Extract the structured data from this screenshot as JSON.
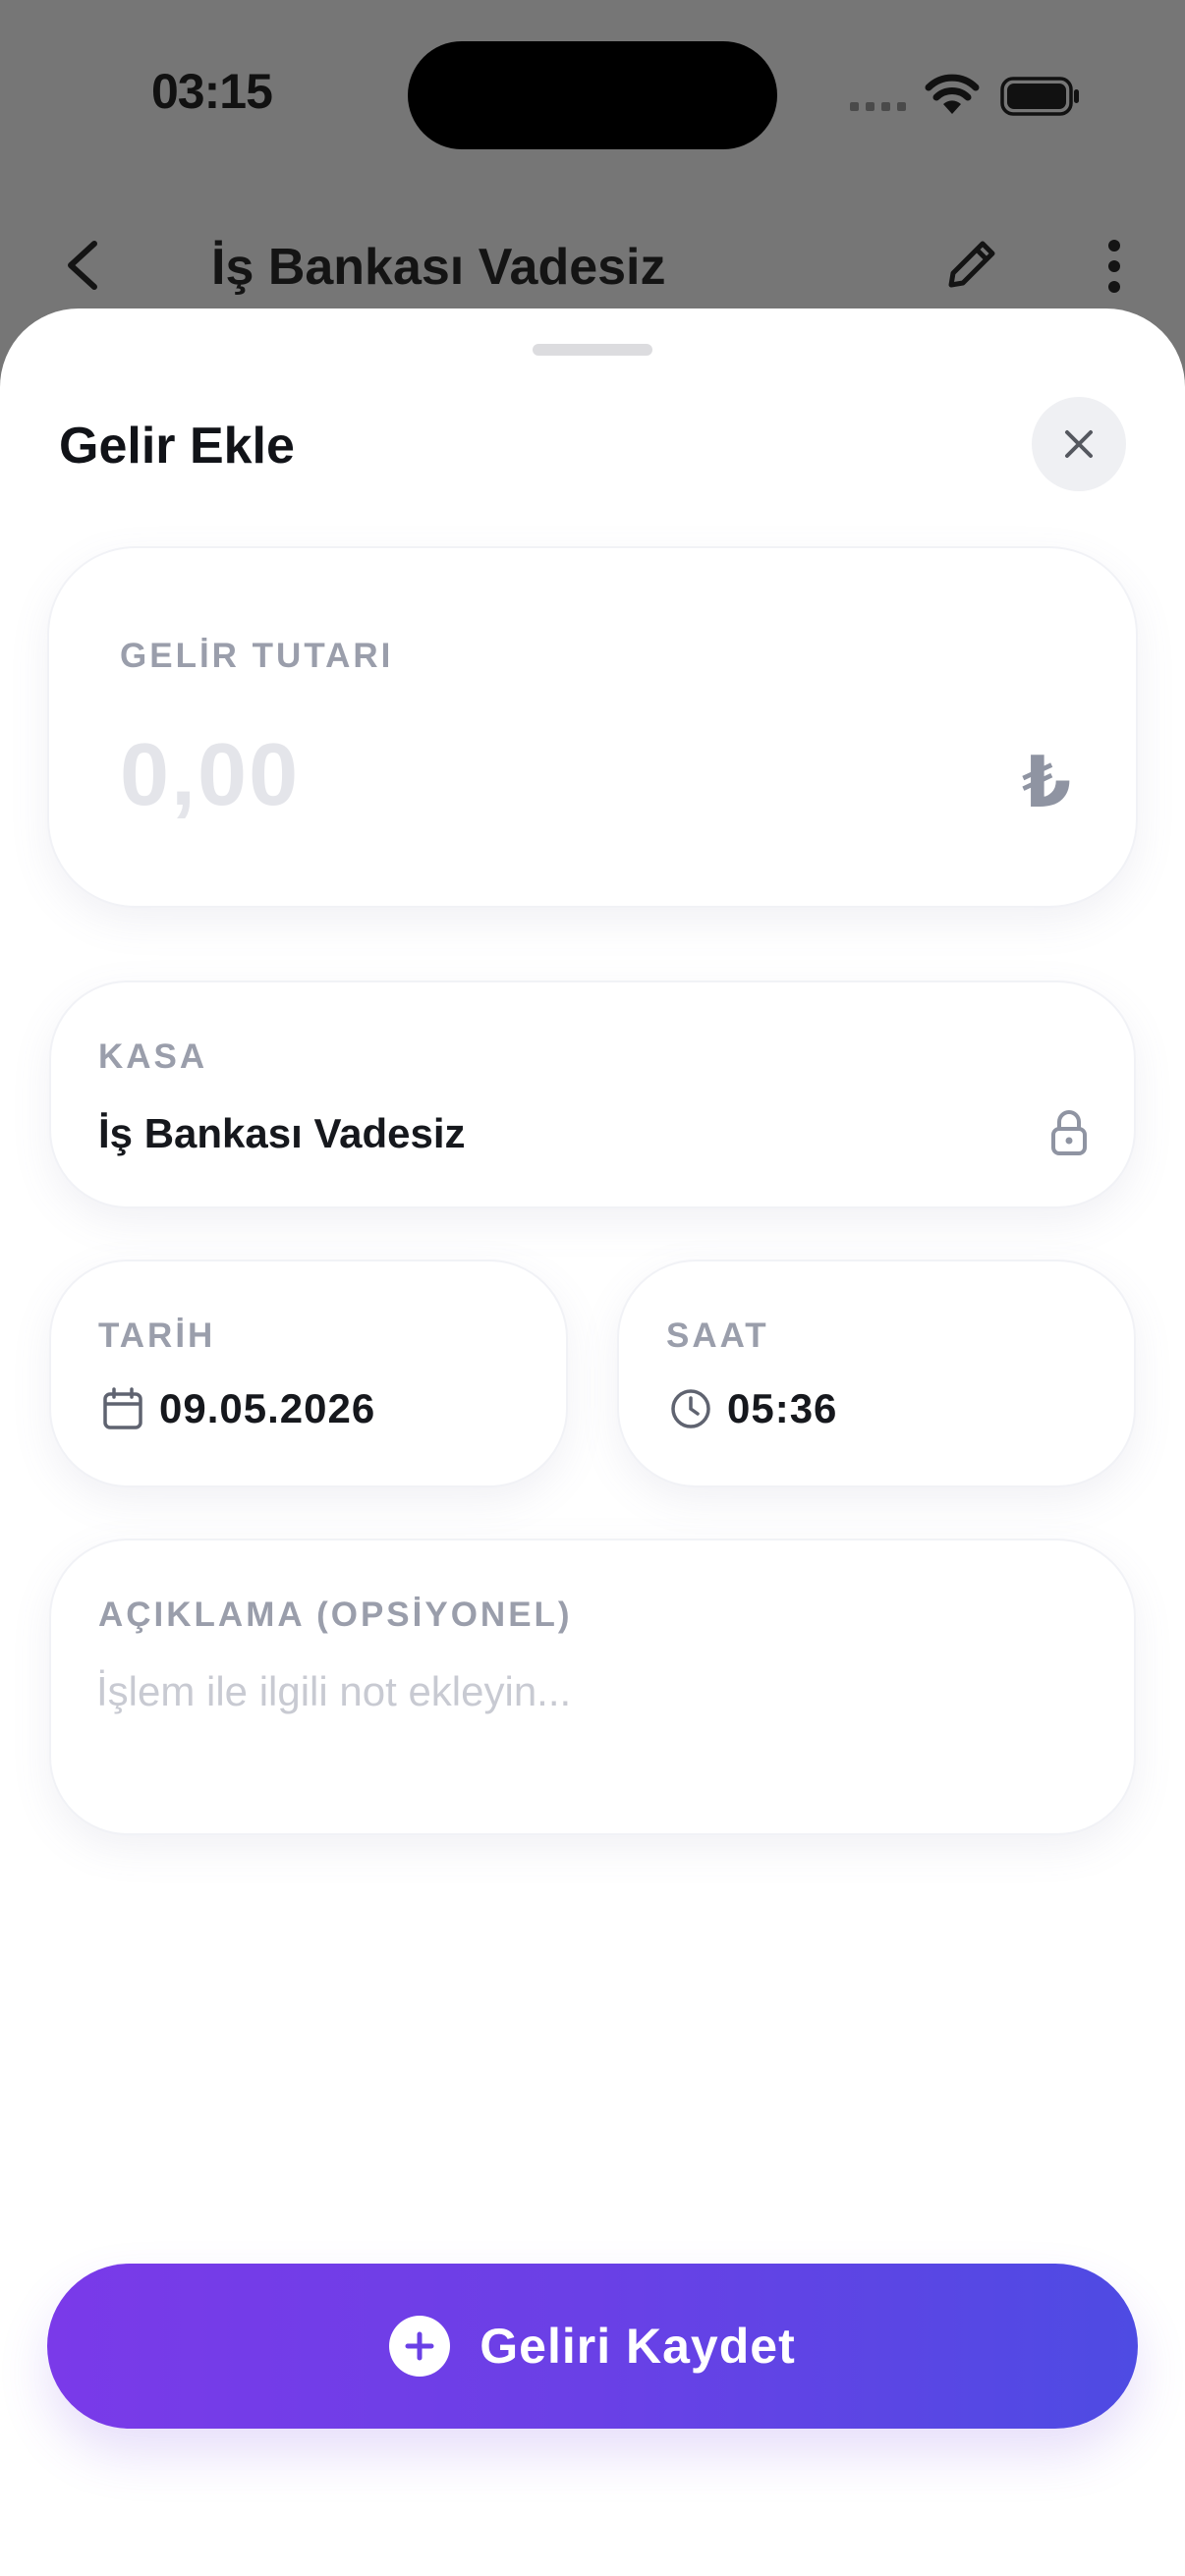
{
  "status_bar": {
    "time": "03:15"
  },
  "page": {
    "title": "İş Bankası Vadesiz"
  },
  "sheet": {
    "title": "Gelir Ekle",
    "amount": {
      "label": "GELİR TUTARI",
      "placeholder": "0,00",
      "currency_symbol": "₺"
    },
    "kasa": {
      "label": "KASA",
      "value": "İş Bankası Vadesiz"
    },
    "date": {
      "label": "TARİH",
      "value": "09.05.2026"
    },
    "time": {
      "label": "SAAT",
      "value": "05:36"
    },
    "description": {
      "label": "AÇIKLAMA (OPSİYONEL)",
      "placeholder": "İşlem ile ilgili not ekleyin..."
    },
    "save_button": {
      "label": "Geliri Kaydet"
    }
  },
  "colors": {
    "accent_start": "#7a3ae9",
    "accent_end": "#4e4be3",
    "backdrop": "#767676",
    "label_gray": "#9a9eab"
  },
  "icons": [
    "back-arrow-icon",
    "pencil-icon",
    "more-vertical-icon",
    "close-icon",
    "lock-icon",
    "calendar-icon",
    "clock-icon",
    "plus-circle-icon",
    "wifi-icon",
    "battery-icon",
    "signal-icon"
  ]
}
